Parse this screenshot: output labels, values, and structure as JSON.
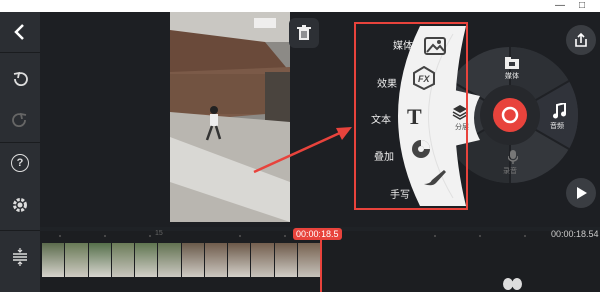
{
  "window": {
    "minimize": "—",
    "maximize": "□"
  },
  "toolbar": {
    "back_icon": "chevron-left-icon",
    "undo_icon": "undo-icon",
    "redo_icon": "redo-icon",
    "help_label": "?",
    "settings_icon": "gear-icon",
    "timeline_icon": "align-icon"
  },
  "preview": {
    "delete_icon": "trash-icon",
    "export_icon": "share-icon",
    "play_icon": "play-icon"
  },
  "layer_menu": {
    "items": [
      {
        "label": "媒体",
        "icon": "image-icon"
      },
      {
        "label": "效果",
        "icon": "fx-icon"
      },
      {
        "label": "文本",
        "icon": "text-icon"
      },
      {
        "label": "叠加",
        "icon": "sticker-icon"
      },
      {
        "label": "手写",
        "icon": "brush-icon"
      }
    ]
  },
  "wheel": {
    "media_label": "媒体",
    "layer_label": "分层",
    "audio_label": "音频",
    "record_label": "录音"
  },
  "timeline": {
    "playhead_time": "00:00:18.5",
    "total_time": "00:00:18.54",
    "scale_label": "15",
    "accent_color": "#e8433c"
  }
}
